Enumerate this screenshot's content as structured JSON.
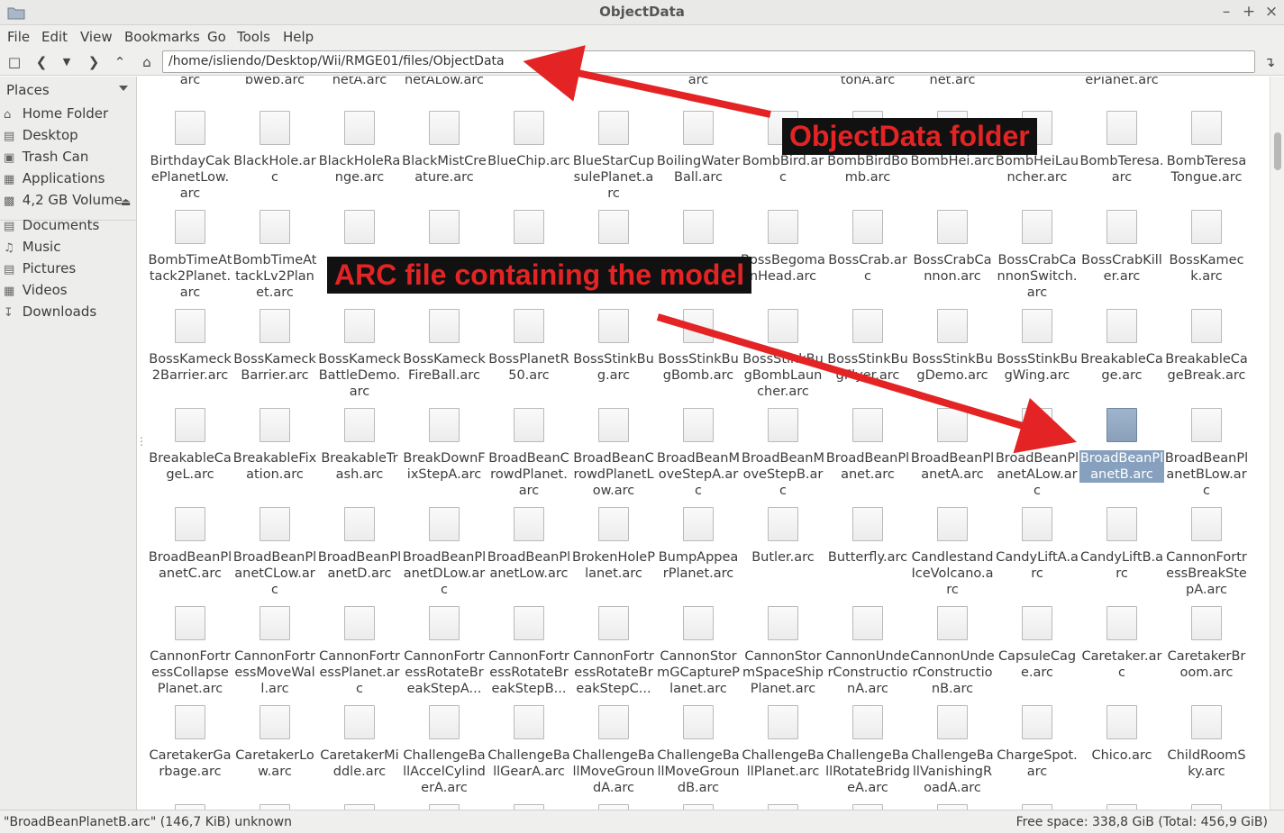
{
  "window": {
    "title": "ObjectData"
  },
  "menu": [
    "File",
    "Edit",
    "View",
    "Bookmarks",
    "Go",
    "Tools",
    "Help"
  ],
  "toolbar": {
    "path": "/home/isliendo/Desktop/Wii/RMGE01/files/ObjectData"
  },
  "sidebar": {
    "header": "Places",
    "items": [
      {
        "label": "Home Folder",
        "icon": "home-icon"
      },
      {
        "label": "Desktop",
        "icon": "desktop-icon"
      },
      {
        "label": "Trash Can",
        "icon": "trash-icon"
      },
      {
        "label": "Applications",
        "icon": "applications-icon"
      },
      {
        "label": "4,2 GB Volume",
        "icon": "drive-icon"
      },
      {
        "label": "Documents",
        "icon": "documents-icon"
      },
      {
        "label": "Music",
        "icon": "music-icon"
      },
      {
        "label": "Pictures",
        "icon": "pictures-icon"
      },
      {
        "label": "Videos",
        "icon": "videos-icon"
      },
      {
        "label": "Downloads",
        "icon": "downloads-icon"
      }
    ]
  },
  "files": {
    "partial_top_row": [
      "arc",
      "bweb.arc",
      "netA.arc",
      "netALow.arc",
      "",
      "",
      "arc",
      "",
      "manSpikePistonA.arc",
      "manSpikePlanet.arc",
      "",
      "ePlanet.arc"
    ],
    "rows": [
      [
        "BirthdayCakePlanetLow.arc",
        "BlackHole.arc",
        "BlackHoleRange.arc",
        "BlackMistCreature.arc",
        "BlueChip.arc",
        "BlueStarCupsulePlanet.arc",
        "BoilingWaterBall.arc",
        "BombBird.arc",
        "BombBirdBomb.arc",
        "BombHei.arc",
        "BombHeiLauncher.arc",
        "BombTeresa.arc",
        "BombTeresaTongue.arc"
      ],
      [
        "BombTimeAttack2Planet.arc",
        "BombTimeAttackLv2Planet.arc",
        "",
        "",
        "",
        "",
        "",
        "BossBegomanHead.arc",
        "BossCrab.arc",
        "BossCrabCannon.arc",
        "BossCrabCannonSwitch.arc",
        "BossCrabKiller.arc",
        "BossKameck.arc"
      ],
      [
        "BossKameck2Barrier.arc",
        "BossKameckBarrier.arc",
        "BossKameckBattleDemo.arc",
        "BossKameckFireBall.arc",
        "BossPlanetR50.arc",
        "BossStinkBug.arc",
        "BossStinkBugBomb.arc",
        "BossStinkBugBombLauncher.arc",
        "BossStinkBugFlyer.arc",
        "BossStinkBugDemo.arc",
        "BossStinkBugWing.arc",
        "BreakableCage.arc",
        "BreakableCageBreak.arc"
      ],
      [
        "BreakableCageL.arc",
        "BreakableFixation.arc",
        "BreakableTrash.arc",
        "BreakDownFixStepA.arc",
        "BroadBeanCrowdPlanet.arc",
        "BroadBeanCrowdPlanetLow.arc",
        "BroadBeanMoveStepA.arc",
        "BroadBeanMoveStepB.arc",
        "BroadBeanPlanet.arc",
        "BroadBeanPlanetA.arc",
        "BroadBeanPlanetALow.arc",
        "BroadBeanPlanetB.arc",
        "BroadBeanPlanetBLow.arc"
      ],
      [
        "BroadBeanPlanetC.arc",
        "BroadBeanPlanetCLow.arc",
        "BroadBeanPlanetD.arc",
        "BroadBeanPlanetDLow.arc",
        "BroadBeanPlanetLow.arc",
        "BrokenHolePlanet.arc",
        "BumpAppearPlanet.arc",
        "Butler.arc",
        "Butterfly.arc",
        "CandlestandIceVolcano.arc",
        "CandyLiftA.arc",
        "CandyLiftB.arc",
        "CannonFortressBreakStepA.arc"
      ],
      [
        "CannonFortressCollapsePlanet.arc",
        "CannonFortressMoveWall.arc",
        "CannonFortressPlanet.arc",
        "CannonFortressRotateBreakStepA...",
        "CannonFortressRotateBreakStepB...",
        "CannonFortressRotateBreakStepC...",
        "CannonStormGCapturePlanet.arc",
        "CannonStormSpaceShipPlanet.arc",
        "CannonUnderConstructionA.arc",
        "CannonUnderConstructionB.arc",
        "CapsuleCage.arc",
        "Caretaker.arc",
        "CaretakerBroom.arc"
      ],
      [
        "CaretakerGarbage.arc",
        "CaretakerLow.arc",
        "CaretakerMiddle.arc",
        "ChallengeBallAccelCylinderA.arc",
        "ChallengeBallGearA.arc",
        "ChallengeBallMoveGroundA.arc",
        "ChallengeBallMoveGroundB.arc",
        "ChallengeBallPlanet.arc",
        "ChallengeBallRotateBridgeA.arc",
        "ChallengeBallVanishingRoadA.arc",
        "ChargeSpot.arc",
        "Chico.arc",
        "ChildRoomSky.arc"
      ]
    ],
    "selected": "BroadBeanPlanetB.arc"
  },
  "annotations": {
    "folder_label": "ObjectData folder",
    "arc_label": "ARC file containing the model",
    "color": "#e42424"
  },
  "status": {
    "left": "\"BroadBeanPlanetB.arc\" (146,7 KiB) unknown",
    "right": "Free space: 338,8 GiB (Total: 456,9 GiB)"
  }
}
